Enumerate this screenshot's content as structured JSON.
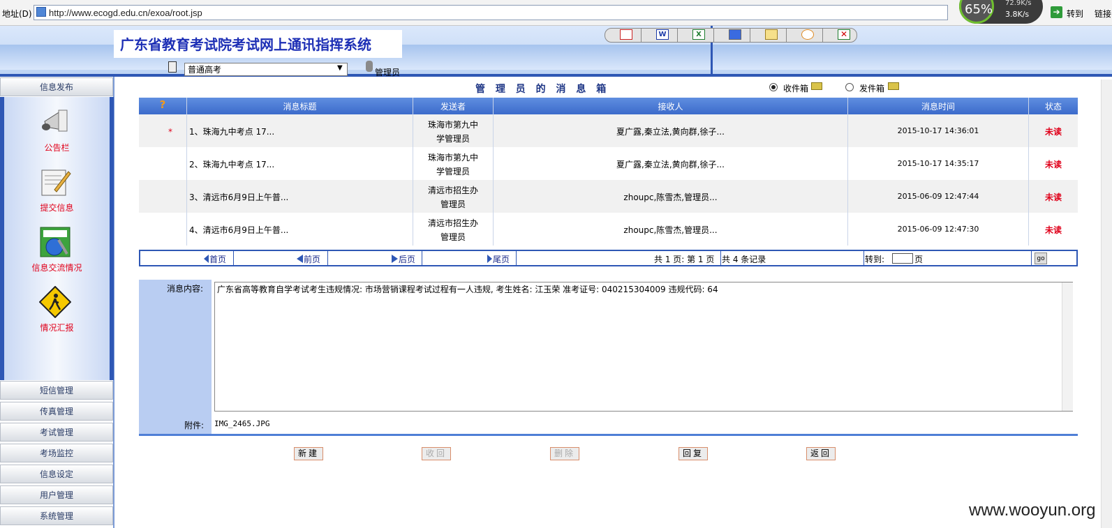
{
  "browser": {
    "address_label": "地址(D)",
    "url": "http://www.ecogd.edu.cn/exoa/root.jsp",
    "speed": {
      "percent": "65%",
      "up": "72.9K/s",
      "down": "3.8K/s"
    },
    "goto_label": "转到",
    "links_label": "链接"
  },
  "header": {
    "title": "广东省教育考试院考试网上通讯指挥系统",
    "exam_type_selected": "普通高考",
    "user_label": "管理员",
    "toolbar_icons": [
      "home-icon",
      "word-icon",
      "excel-icon",
      "document-icon",
      "mail-icon",
      "clock-icon",
      "exit-icon"
    ]
  },
  "sidebar": {
    "top_section": "信息发布",
    "items": [
      {
        "label": "公告栏",
        "icon": "megaphone-icon"
      },
      {
        "label": "提交信息",
        "icon": "write-icon"
      },
      {
        "label": "信息交流情况",
        "icon": "exchange-icon"
      },
      {
        "label": "情况汇报",
        "icon": "warning-sign-icon"
      }
    ],
    "sections": [
      "短信管理",
      "传真管理",
      "考试管理",
      "考场监控",
      "信息设定",
      "用户管理",
      "系统管理"
    ]
  },
  "mailbox": {
    "title": "管 理 员 的 消 息 箱",
    "inbox_label": "收件箱",
    "outbox_label": "发件箱",
    "selected": "inbox"
  },
  "table": {
    "headers": [
      "?",
      "消息标题",
      "发送者",
      "接收人",
      "消息时间",
      "状态"
    ],
    "rows": [
      {
        "mark": "*",
        "title": "1、珠海九中考点 17...",
        "sender_line1": "珠海市第九中",
        "sender_line2": "学管理员",
        "receivers": "夏广露,秦立法,黄向群,徐子...",
        "time": "2015-10-17 14:36:01",
        "status": "未读"
      },
      {
        "mark": "",
        "title": "2、珠海九中考点 17...",
        "sender_line1": "珠海市第九中",
        "sender_line2": "学管理员",
        "receivers": "夏广露,秦立法,黄向群,徐子...",
        "time": "2015-10-17 14:35:17",
        "status": "未读"
      },
      {
        "mark": "",
        "title": "3、清远市6月9日上午普...",
        "sender_line1": "清远市招生办",
        "sender_line2": "管理员",
        "receivers": "zhoupc,陈雪杰,管理员...",
        "time": "2015-06-09 12:47:44",
        "status": "未读"
      },
      {
        "mark": "",
        "title": "4、清远市6月9日上午普...",
        "sender_line1": "清远市招生办",
        "sender_line2": "管理员",
        "receivers": "zhoupc,陈雪杰,管理员...",
        "time": "2015-06-09 12:47:30",
        "status": "未读"
      }
    ]
  },
  "pager": {
    "first": "首页",
    "prev": "前页",
    "next": "后页",
    "last": "尾页",
    "page_info": "共 1 页: 第 1 页",
    "record_info": "共 4 条记录",
    "goto_label": "转到:",
    "page_suffix": "页",
    "go": "go"
  },
  "detail": {
    "content_label": "消息内容:",
    "content": "广东省高等教育自学考试考生违规情况: 市场营销课程考试过程有一人违规, 考生姓名: 江玉荣  准考证号: 040215304009 违规代码: 64",
    "attachment_label": "附件:",
    "attachment": "IMG_2465.JPG"
  },
  "actions": {
    "new": "新建",
    "recall": "收回",
    "delete": "删除",
    "reply": "回复",
    "back": "返回"
  },
  "watermark": "www.wooyun.org"
}
